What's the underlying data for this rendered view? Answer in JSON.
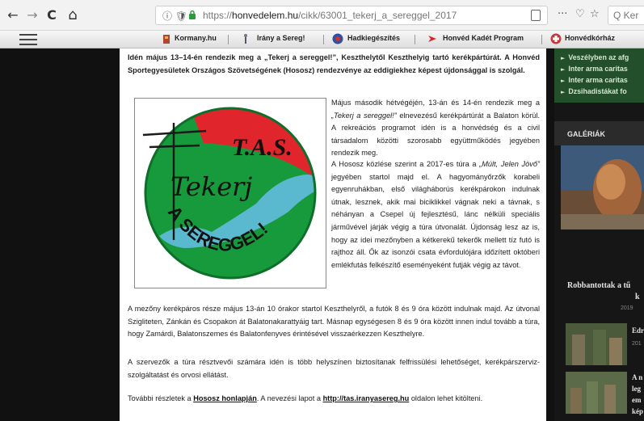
{
  "browser": {
    "back_glyph": "←",
    "forward_glyph": "→",
    "reload_glyph": "C",
    "home_glyph": "⌂",
    "info_glyph": "ⓘ 🛡",
    "url_prefix": "https://",
    "url_host": "honvedelem.hu",
    "url_path": "/cikk/63001_tekerj_a_sereggel_2017",
    "more_glyph": "···",
    "pocket_glyph": "♡",
    "star_glyph": "☆",
    "search_placeholder": "Q Ker"
  },
  "sitebar": {
    "links": [
      "Kormany.hu",
      "Irány a Sereg!",
      "Hadkiegészítés",
      "Honvéd Kadét Program",
      "Honvédkórház"
    ]
  },
  "article": {
    "lead_1": "Idén május 13–14-én rendezik meg a „Tekerj a sereggel!”, Keszthelytől Keszthelyig tartó kerékpártúrát.",
    "lead_2": "A Honvéd Sportegyesületek Országos Szövetségének (Hososz) rendezvénye az eddigiekhez képest újdonsággal is szolgál.",
    "p1_a": "Május második hétvégéjén, 13-án és 14-én rendezik meg a ",
    "p1_em": "„Tekerj a sereggel!”",
    "p1_b": " elnevezésű kerékpártúrát a Balaton körül. A rekreációs programot idén is a honvédség és a civil társadalom közötti szorosabb együttműködés jegyében rendezik meg.",
    "p2_a": "A Hososz közlése szerint a 2017-es túra a ",
    "p2_em": "„Múlt, Jelen Jövő”",
    "p2_b": " jegyében startol majd el. A hagyományőrzők korabeli egyenruhákban, első világháborús kerékpárokon indulnak útnak, lesznek, akik mai biciklikkel vágnak neki a távnak, s néhányan a Csepel új fejlesztésű, lánc nélküli speciális járművével járják végig a túra útvonalát. Újdonság lesz az is, hogy az idei mezőnyben a kétkerekű tekerők mellett tíz futó is rajthoz áll. Ők az isonzói csata évfordulójára időzített októberi emlékfutás felkészítő eseményeként futják végig az távot.",
    "p3": "A mezőny kerékpáros része május 13-án 10 órakor startol Keszthelyről, a futók 8 és 9 óra között indulnak majd. Az útvonal Szigliteten, Zánkán és Csopakon át Balatonakarattyáig tart. Másnap egységesen 8 és 9 óra között innen indul tovább a túra, hogy Zamárdi, Balatonszemes és Balatonfenyves érintésével visszaérkezzen Keszthelyre.",
    "p4": "A szervezők a túra résztvevői számára idén is több helyszínen biztosítanak felfrissülési lehetőséget, kerékpárszerviz-szolgáltatást és orvosi ellátást.",
    "p5_a": "További részletek a ",
    "p5_link1": "Hososz honlapján",
    "p5_b": ". A nevezési lapot a ",
    "p5_link2": "http://tas.iranyasereg.hu",
    "p5_c": " oldalon lehet kitölteni."
  },
  "logo": {
    "top_text": "T.A.S.",
    "middle_text": "Tekerj",
    "bottom_text": "A SEREGGEL!"
  },
  "sidebar": {
    "items": [
      "Veszélyben az afg",
      "Inter arma caritas",
      "Inter arma caritas",
      "Dzsihadistákat fo"
    ],
    "gallery_title": "GALÉRIÁK",
    "feature_caption_1": "Robbantottak a tű",
    "feature_caption_2": "k",
    "feature_date": "2019",
    "thumb_1_caption": "Edr",
    "thumb_1_date": "201",
    "thumb_2_lines": [
      "A n",
      "leg",
      "em",
      "kép"
    ]
  },
  "colors": {
    "logo_green": "#179a3c",
    "logo_red": "#e0262c",
    "lake_blue": "#5bb9cf",
    "sidebar_green": "#234f2a"
  }
}
